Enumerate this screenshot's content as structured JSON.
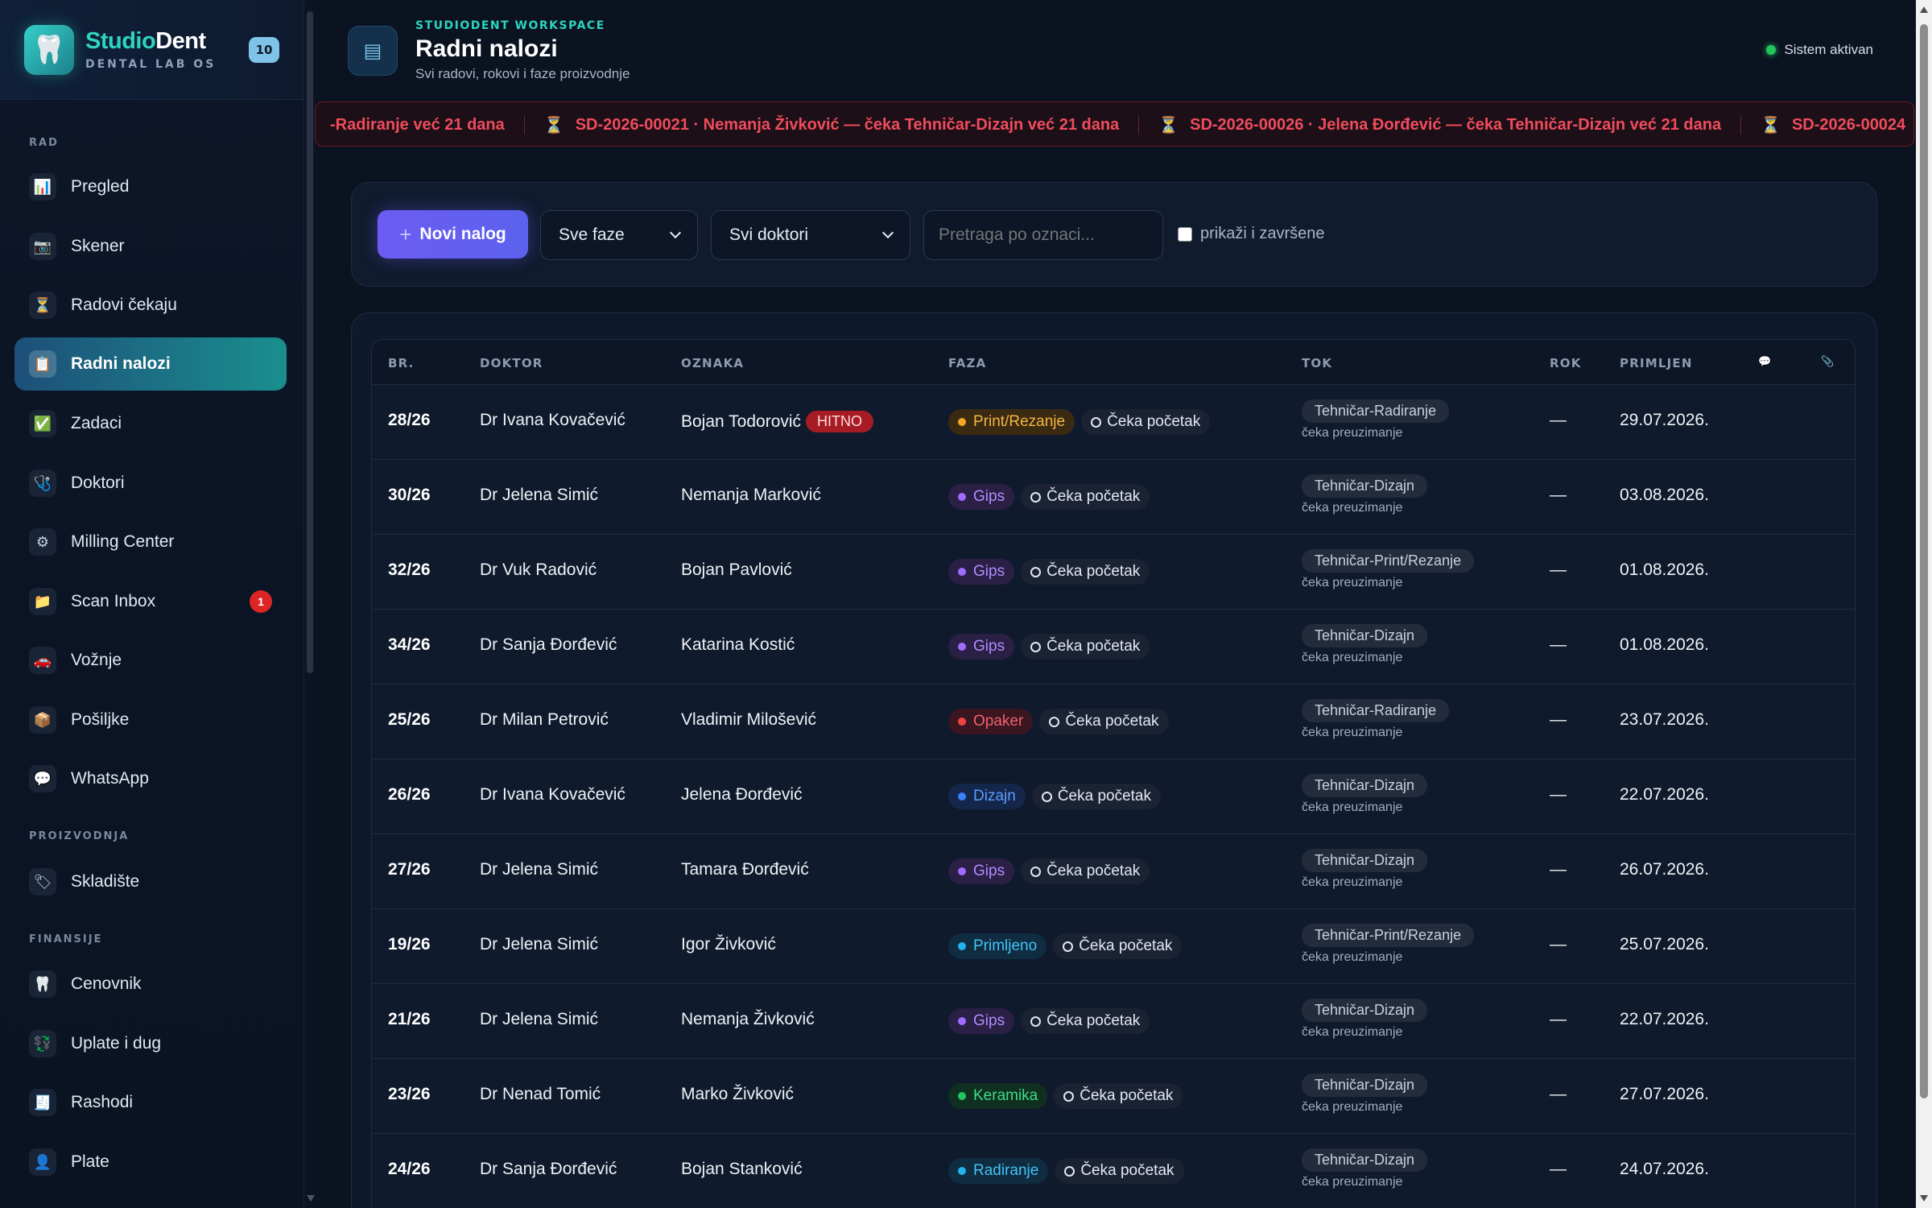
{
  "brand": {
    "name_part1": "Studio",
    "name_part2": "Dent",
    "subtitle": "DENTAL LAB OS",
    "badge": "10"
  },
  "sidebar": {
    "sections": [
      {
        "label": "RAD"
      },
      {
        "label": "PROIZVODNJA"
      },
      {
        "label": "FINANSIJE"
      }
    ],
    "items": [
      {
        "label": "Pregled",
        "icon": "📊"
      },
      {
        "label": "Skener",
        "icon": "📷"
      },
      {
        "label": "Radovi čekaju",
        "icon": "⏳"
      },
      {
        "label": "Radni nalozi",
        "icon": "📋",
        "active": true
      },
      {
        "label": "Zadaci",
        "icon": "✅"
      },
      {
        "label": "Doktori",
        "icon": "🩺"
      },
      {
        "label": "Milling Center",
        "icon": "⚙"
      },
      {
        "label": "Scan Inbox",
        "icon": "📁",
        "badge": "1"
      },
      {
        "label": "Vožnje",
        "icon": "🚗"
      },
      {
        "label": "Pošiljke",
        "icon": "📦"
      },
      {
        "label": "WhatsApp",
        "icon": "💬"
      },
      {
        "label": "Skladište",
        "icon": "🏷"
      },
      {
        "label": "Cenovnik",
        "icon": "🦷"
      },
      {
        "label": "Uplate i dug",
        "icon": "💱"
      },
      {
        "label": "Rashodi",
        "icon": "🧾"
      },
      {
        "label": "Plate",
        "icon": "👤"
      }
    ]
  },
  "header": {
    "kicker": "STUDIODENT WORKSPACE",
    "title": "Radni nalozi",
    "subtitle": "Svi radovi, rokovi i faze proizvodnje",
    "status": "Sistem aktivan"
  },
  "ticker": {
    "items": [
      "-Radiranje već 21 dana",
      "SD-2026-00021 · Nemanja Živković — čeka Tehničar-Dizajn već 21 dana",
      "SD-2026-00026 · Jelena Đorđević — čeka Tehničar-Dizajn već 21 dana",
      "SD-2026-00024"
    ]
  },
  "filters": {
    "new_button": "Novi nalog",
    "phase_select": "Sve faze",
    "doctor_select": "Svi doktori",
    "search_placeholder": "Pretraga po oznaci...",
    "show_done_label": "prikaži i završene"
  },
  "table": {
    "headers": {
      "br": "BR.",
      "doktor": "DOKTOR",
      "oznaka": "OZNAKA",
      "faza": "FAZA",
      "tok": "TOK",
      "rok": "ROK",
      "primljen": "PRIMLJEN"
    },
    "wait_label": "Čeka početak",
    "tok_sub": "čeka preuzimanje",
    "urgent_label": "HITNO",
    "rows": [
      {
        "br": "28/26",
        "doktor": "Dr Ivana Kovačević",
        "oznaka": "Bojan Todorović",
        "urgent": true,
        "faza": "Print/Rezanje",
        "tok": "Tehničar-Radiranje",
        "rok": "—",
        "primljen": "29.07.2026."
      },
      {
        "br": "30/26",
        "doktor": "Dr Jelena Simić",
        "oznaka": "Nemanja Marković",
        "faza": "Gips",
        "tok": "Tehničar-Dizajn",
        "rok": "—",
        "primljen": "03.08.2026."
      },
      {
        "br": "32/26",
        "doktor": "Dr Vuk Radović",
        "oznaka": "Bojan Pavlović",
        "faza": "Gips",
        "tok": "Tehničar-Print/Rezanje",
        "rok": "—",
        "primljen": "01.08.2026."
      },
      {
        "br": "34/26",
        "doktor": "Dr Sanja Đorđević",
        "oznaka": "Katarina Kostić",
        "faza": "Gips",
        "tok": "Tehničar-Dizajn",
        "rok": "—",
        "primljen": "01.08.2026."
      },
      {
        "br": "25/26",
        "doktor": "Dr Milan Petrović",
        "oznaka": "Vladimir Milošević",
        "faza": "Opaker",
        "tok": "Tehničar-Radiranje",
        "rok": "—",
        "primljen": "23.07.2026."
      },
      {
        "br": "26/26",
        "doktor": "Dr Ivana Kovačević",
        "oznaka": "Jelena Đorđević",
        "faza": "Dizajn",
        "tok": "Tehničar-Dizajn",
        "rok": "—",
        "primljen": "22.07.2026."
      },
      {
        "br": "27/26",
        "doktor": "Dr Jelena Simić",
        "oznaka": "Tamara Đorđević",
        "faza": "Gips",
        "tok": "Tehničar-Dizajn",
        "rok": "—",
        "primljen": "26.07.2026."
      },
      {
        "br": "19/26",
        "doktor": "Dr Jelena Simić",
        "oznaka": "Igor Živković",
        "faza": "Primljeno",
        "tok": "Tehničar-Print/Rezanje",
        "rok": "—",
        "primljen": "25.07.2026."
      },
      {
        "br": "21/26",
        "doktor": "Dr Jelena Simić",
        "oznaka": "Nemanja Živković",
        "faza": "Gips",
        "tok": "Tehničar-Dizajn",
        "rok": "—",
        "primljen": "22.07.2026."
      },
      {
        "br": "23/26",
        "doktor": "Dr Nenad Tomić",
        "oznaka": "Marko Živković",
        "faza": "Keramika",
        "tok": "Tehničar-Dizajn",
        "rok": "—",
        "primljen": "27.07.2026."
      },
      {
        "br": "24/26",
        "doktor": "Dr Sanja Đorđević",
        "oznaka": "Bojan Stanković",
        "faza": "Radiranje",
        "tok": "Tehničar-Dizajn",
        "rok": "—",
        "primljen": "24.07.2026."
      }
    ]
  },
  "phase_colors": {
    "Print/Rezanje": {
      "bg": "#3b2a12",
      "fg": "#f5b642",
      "dot": "#f5a623"
    },
    "Gips": {
      "bg": "#2a1f45",
      "fg": "#b28cff",
      "dot": "#a06bff"
    },
    "Opaker": {
      "bg": "#3a1720",
      "fg": "#f26070",
      "dot": "#ef4444"
    },
    "Dizajn": {
      "bg": "#14264a",
      "fg": "#5d9cff",
      "dot": "#3b82f6"
    },
    "Primljeno": {
      "bg": "#0f2c40",
      "fg": "#43c3f5",
      "dot": "#22b3ee"
    },
    "Keramika": {
      "bg": "#0f3020",
      "fg": "#3ddc84",
      "dot": "#22c55e"
    },
    "Radiranje": {
      "bg": "#0f2c40",
      "fg": "#43c3f5",
      "dot": "#22b3ee"
    }
  }
}
